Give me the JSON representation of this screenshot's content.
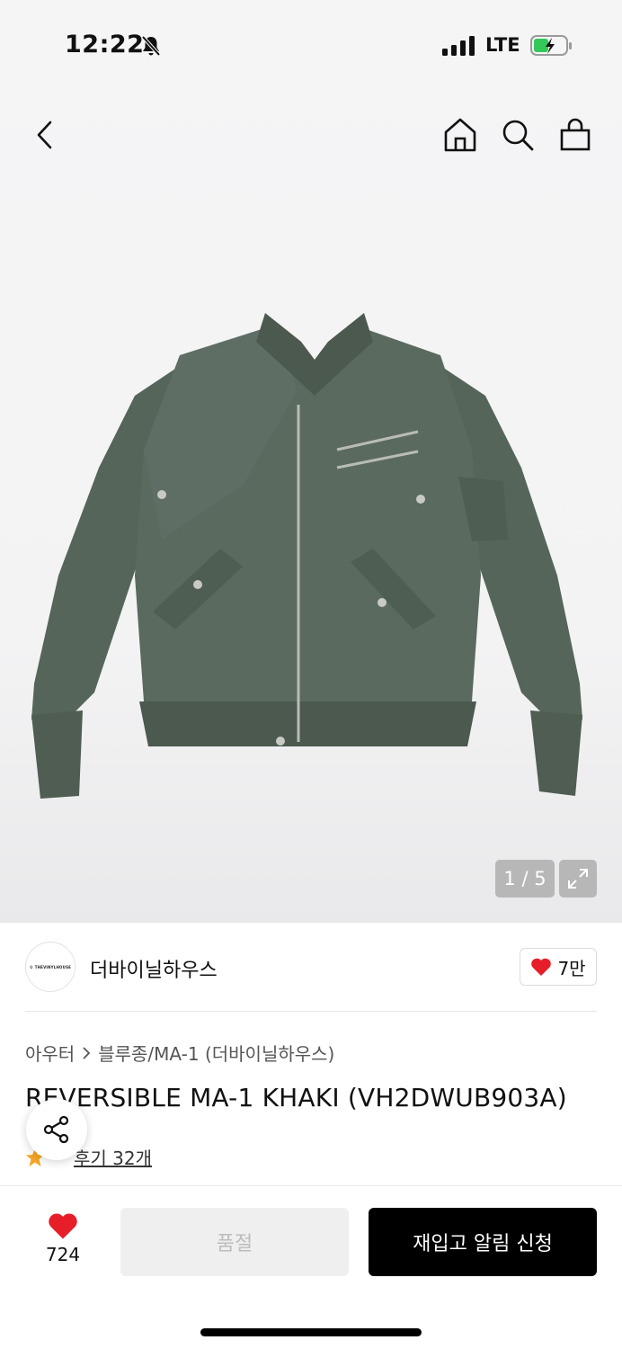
{
  "status_bar": {
    "time": "12:22",
    "network": "LTE"
  },
  "header": {
    "icons": [
      "back-icon",
      "home-icon",
      "search-icon",
      "cart-icon"
    ]
  },
  "gallery": {
    "counter": "1 / 5"
  },
  "brand": {
    "logo_text": "© THEVINYLHOUSE",
    "name": "더바이닐하우스",
    "likes": "7만"
  },
  "breadcrumb": {
    "category": "아우터",
    "subcategory": "블루종/MA-1 (더바이닐하우스)"
  },
  "product": {
    "title": "REVERSIBLE MA-1 KHAKI (VH2DWUB903A)",
    "review_link": "후기 32개"
  },
  "bottom_bar": {
    "wish_count": "724",
    "soldout_label": "품절",
    "restock_label": "재입고 알림 신청"
  },
  "colors": {
    "accent": "#e61e29",
    "star": "#f5a623",
    "jacket": "#56655a",
    "lining": "#f26a21"
  }
}
